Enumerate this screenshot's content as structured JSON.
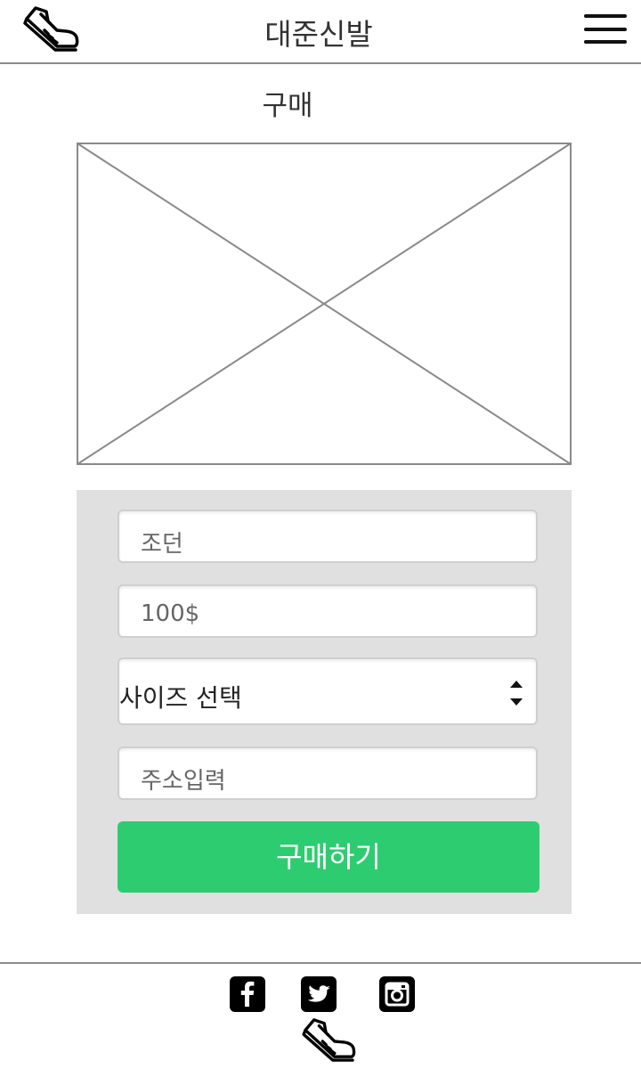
{
  "header": {
    "brand": "대준신발",
    "logo_icon": "shoe-icon",
    "menu_icon": "hamburger-menu-icon"
  },
  "page": {
    "title": "구매",
    "image_placeholder_icon": "image-placeholder-icon"
  },
  "form": {
    "product_name": "조던",
    "price": "100$",
    "size_select": "사이즈 선택",
    "size_select_icon": "sort-arrows-icon",
    "address_placeholder": "주소입력",
    "buy_button": "구매하기"
  },
  "footer": {
    "social_icons": [
      "facebook-icon",
      "twitter-icon",
      "instagram-icon"
    ],
    "logo_icon": "shoe-icon"
  },
  "colors": {
    "accent": "#2ecc71",
    "panel": "#e0e0e0",
    "border": "#8a8a8a"
  }
}
